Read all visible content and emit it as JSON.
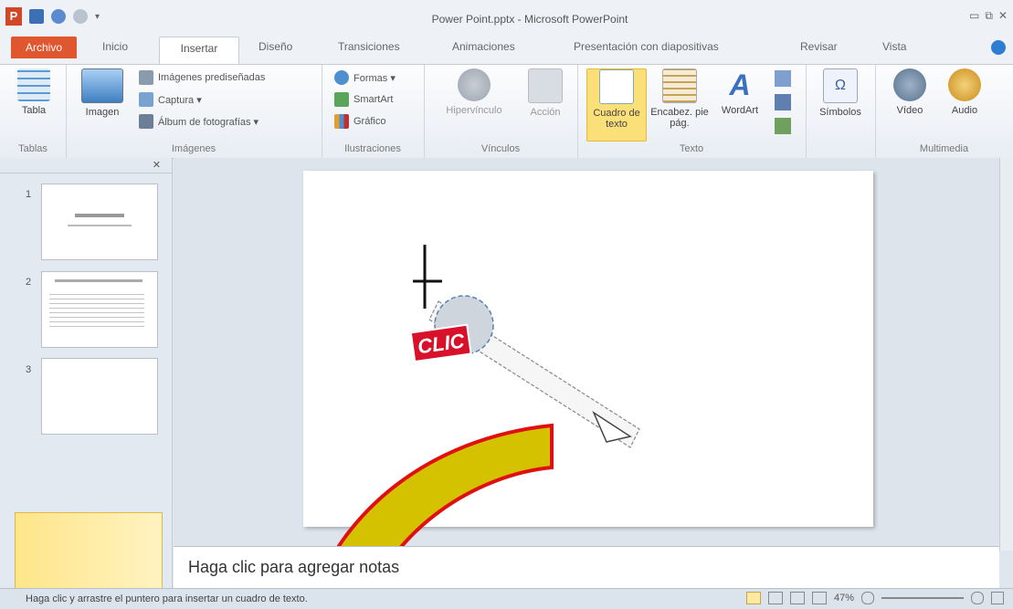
{
  "window": {
    "title": "Power Point.pptx - Microsoft PowerPoint",
    "controls": [
      "▭",
      "⧉",
      "✕"
    ]
  },
  "tabs": {
    "file": "Archivo",
    "items": [
      "Inicio",
      "Insertar",
      "Diseño",
      "Transiciones",
      "Animaciones",
      "Presentación con diapositivas",
      "Revisar",
      "Vista"
    ]
  },
  "ribbon": {
    "tablas": {
      "label": "Tablas",
      "tabla": "Tabla"
    },
    "imagenes": {
      "label": "Imágenes",
      "imagen": "Imagen",
      "prediseñadas": "Imágenes prediseñadas",
      "captura": "Captura ▾",
      "album": "Álbum de fotografías ▾"
    },
    "ilustraciones": {
      "label": "Ilustraciones",
      "formas": "Formas ▾",
      "smartart": "SmartArt",
      "grafico": "Gráfico"
    },
    "vinculos": {
      "label": "Vínculos",
      "hipervinculo": "Hipervínculo",
      "accion": "Acción"
    },
    "texto": {
      "label": "Texto",
      "cuadro": "Cuadro de texto",
      "encabez": "Encabez. pie pág.",
      "wordart": "WordArt"
    },
    "simbolos": {
      "label": "",
      "simbolos": "Símbolos"
    },
    "multimedia": {
      "label": "Multimedia",
      "video": "Vídeo",
      "audio": "Audio"
    }
  },
  "thumbnails": {
    "slides": [
      {
        "num": "1"
      },
      {
        "num": "2"
      },
      {
        "num": "3"
      }
    ]
  },
  "slide": {
    "badge": "CLIC"
  },
  "notes": {
    "placeholder": "Haga clic para agregar notas"
  },
  "status": {
    "text": "Haga clic y arrastre el puntero para insertar un cuadro de texto.",
    "zoom": "47%"
  },
  "colors": {
    "file_tab": "#e0562f",
    "highlight": "#fbe07a",
    "arrow_fill": "#d4c200",
    "arrow_stroke": "#e01010",
    "badge_red": "#d8102a"
  },
  "icons": [
    "table-icon",
    "picture-icon",
    "clipart-icon",
    "screenshot-icon",
    "album-icon",
    "shapes-icon",
    "smartart-icon",
    "chart-icon",
    "hyperlink-icon",
    "action-icon",
    "textbox-icon",
    "header-footer-icon",
    "wordart-icon",
    "symbol-icon",
    "video-icon",
    "audio-icon",
    "crosshair-cursor-icon",
    "mouse-drag-icon"
  ]
}
